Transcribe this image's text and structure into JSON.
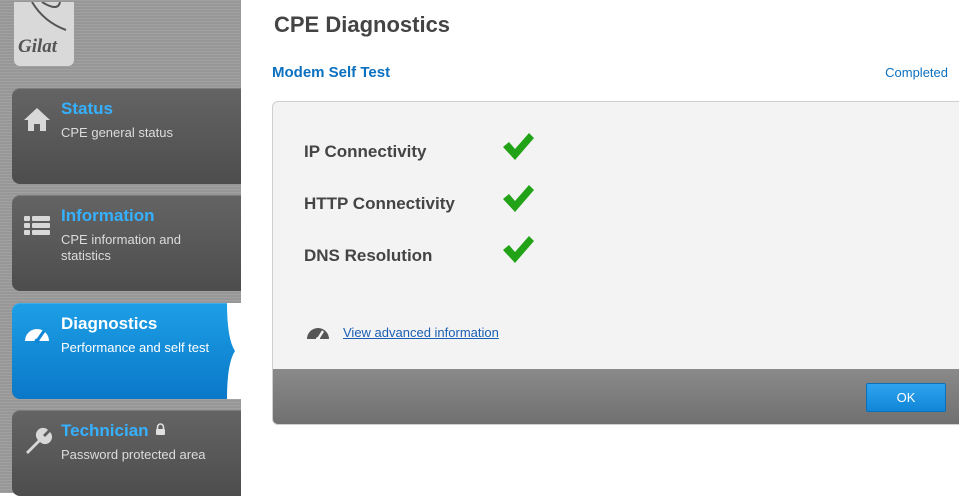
{
  "logo": {
    "text": "Gilat"
  },
  "sidebar": {
    "items": [
      {
        "title": "Status",
        "desc": "CPE general status",
        "icon": "home-icon"
      },
      {
        "title": "Information",
        "desc": "CPE information and statistics",
        "icon": "list-icon"
      },
      {
        "title": "Diagnostics",
        "desc": "Performance and self test",
        "icon": "gauge-icon",
        "active": true
      },
      {
        "title": "Technician",
        "desc": "Password protected area",
        "icon": "wrench-icon",
        "locked": true
      }
    ]
  },
  "main": {
    "title": "CPE Diagnostics",
    "section_title": "Modem Self Test",
    "status": "Completed",
    "checks": [
      {
        "label": "IP Connectivity",
        "result": "pass"
      },
      {
        "label": "HTTP Connectivity",
        "result": "pass"
      },
      {
        "label": "DNS Resolution",
        "result": "pass"
      }
    ],
    "advanced_link": "View advanced information",
    "ok_label": "OK"
  },
  "colors": {
    "accent_blue": "#0f86d6",
    "link_blue": "#0a70c0",
    "check_green": "#22a317",
    "sidebar_bg": "#9c9c9c"
  }
}
